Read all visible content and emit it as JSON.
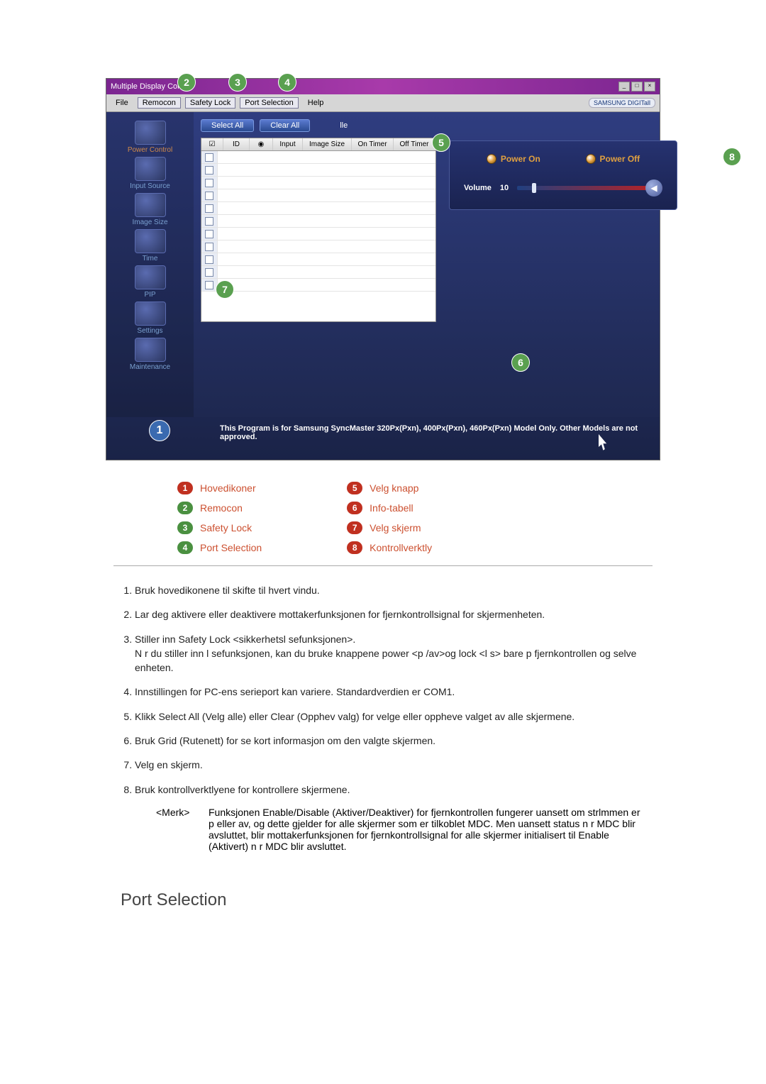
{
  "app": {
    "title": "Multiple Display Control",
    "menu": {
      "file": "File",
      "remocon": "Remocon",
      "safety_lock": "Safety Lock",
      "port_selection": "Port Selection",
      "help": "Help"
    },
    "brand_tag": "SAMSUNG DIGITall",
    "sidebar": {
      "power_control": "Power Control",
      "input_source": "Input Source",
      "image_size": "Image Size",
      "time": "Time",
      "pip": "PIP",
      "settings": "Settings",
      "maintenance": "Maintenance"
    },
    "buttons": {
      "select_all": "Select All",
      "clear_all": "Clear All",
      "title_suffix": "lle"
    },
    "grid_headers": {
      "id": "ID",
      "input": "Input",
      "image_size": "Image Size",
      "on_timer": "On Timer",
      "off_timer": "Off Timer"
    },
    "control": {
      "power_on": "Power On",
      "power_off": "Power Off",
      "volume_label": "Volume",
      "volume_value": "10"
    },
    "footer": "This Program is for Samsung SyncMaster 320Px(Pxn), 400Px(Pxn), 460Px(Pxn)  Model Only. Other Models are not approved."
  },
  "legend": {
    "l1": "Hovedikoner",
    "l2": "Remocon",
    "l3": "Safety Lock",
    "l4": "Port Selection",
    "l5": "Velg knapp",
    "l6": "Info-tabell",
    "l7": "Velg skjerm",
    "l8": "Kontrollverktly"
  },
  "list": {
    "i1": "Bruk hovedikonene til   skifte til hvert vindu.",
    "i2": "Lar deg aktivere eller deaktivere mottakerfunksjonen for fjernkontrollsignal for skjermenheten.",
    "i3a": "Stiller inn Safety Lock <sikkerhetsl sefunksjonen>.",
    "i3b": "N r du stiller inn l sefunksjonen, kan du bruke knappene   power <p /av>og lock <l s> bare p  fjernkontrollen og selve enheten.",
    "i4": "Innstillingen for PC-ens serieport kan variere. Standardverdien er COM1.",
    "i5": "Klikk Select All (Velg alle) eller Clear (Opphev valg) for   velge eller oppheve valget av alle skjermene.",
    "i6": "Bruk Grid (Rutenett) for   se kort informasjon om den valgte skjermen.",
    "i7": "Velg en skjerm.",
    "i8": "Bruk kontrollverktlyene for   kontrollere skjermene.",
    "note_tag": "<Merk>",
    "note_txt": "Funksjonen Enable/Disable (Aktiver/Deaktiver) for fjernkontrollen fungerer uansett om strlmmen er p eller av, og dette gjelder for alle skjermer som er tilkoblet MDC. Men uansett status n r MDC blir avsluttet, blir mottakerfunksjonen for fjernkontrollsignal for alle skjermer initialisert til Enable (Aktivert) n r MDC blir avsluttet."
  },
  "section_heading": "Port Selection"
}
